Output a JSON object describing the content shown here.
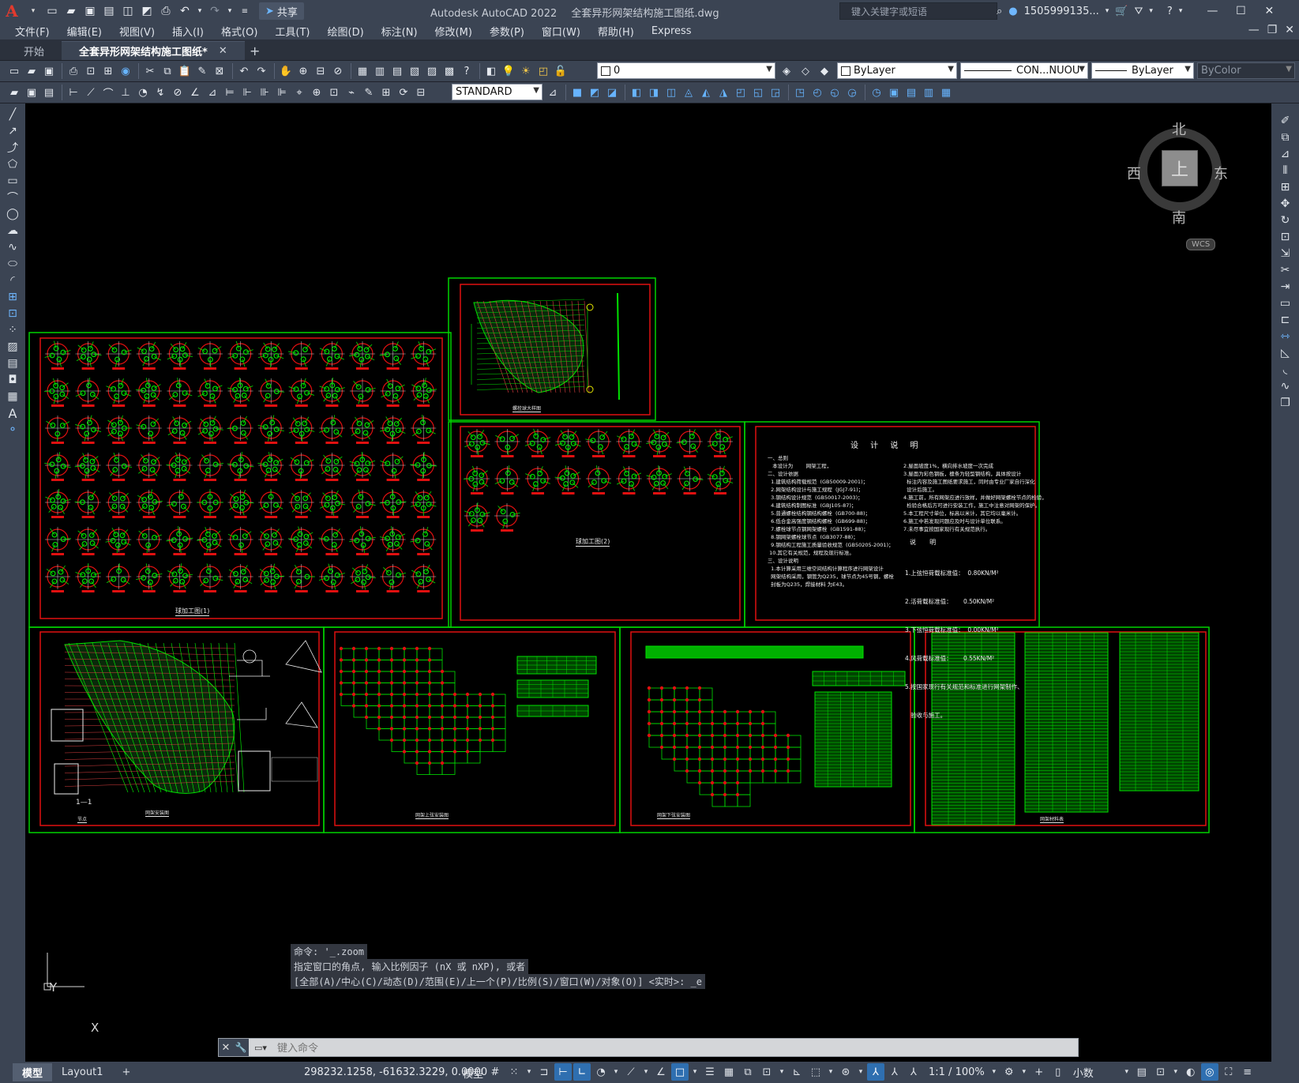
{
  "app": {
    "name": "Autodesk AutoCAD 2022",
    "file": "全套异形网架结构施工图纸.dwg",
    "logo": "A",
    "search_placeholder": "键入关键字或短语",
    "user": "1505999135...",
    "share_label": "共享"
  },
  "menu": [
    "文件(F)",
    "编辑(E)",
    "视图(V)",
    "插入(I)",
    "格式(O)",
    "工具(T)",
    "绘图(D)",
    "标注(N)",
    "修改(M)",
    "参数(P)",
    "窗口(W)",
    "帮助(H)",
    "Express"
  ],
  "tabs": [
    {
      "label": "开始",
      "active": false
    },
    {
      "label": "全套异形网架结构施工图纸*",
      "active": true
    }
  ],
  "toolbar": {
    "layer_value": "0",
    "color_value": "ByLayer",
    "linetype_value": "CON...NUOU",
    "lineweight_value": "ByLayer",
    "plotstyle_value": "ByColor",
    "textstyle_value": "STANDARD"
  },
  "viewcube": {
    "north": "北",
    "south": "南",
    "east": "东",
    "west": "西",
    "face": "上",
    "wcs": "WCS"
  },
  "drawing": {
    "notes_title": "设 计 说 明",
    "notes_left": "一、总则\n   本设计为        网架工程，\n二、设计依据\n  1.建筑结构荷载规范  (GB50009-2001)；\n  2.网架结构设计与施工规程  (JGJ7-91)；\n  3.钢结构设计规范  (GB50017-2003)；\n  4.建筑结构制图标准  (GBJ105-87)；\n  5.普通螺栓结构钢结构螺栓  (GB700-88)；\n  6.低合金高强度钢结构螺栓  (GB699-88)；\n  7.螺栓球节点钢网架螺栓  (GB1591-88)；\n  8.钢网架螺栓球节点  (GB3077-88)；\n  9.钢结构工程施工质量验收规范  (GB50205-2001)；\n 10.其它有关规范，规程及现行标准。\n三、设计说明\n  1.本计算采用三维空间结构计算程序进行网架设计\n  网架结构采用，钢管为Q235，球节点为45号钢，螺栓\n  封板为Q235，焊接材料 为E43。",
    "notes_right": "2.屋面坡度1%，横向排水坡度一次完成\n3.屋面为彩色钢板，檩条为轻型钢结构，具体按设计\n  标注内容及施工图纸要求施工，同时由专业厂家自行深化\n  设计后施工。\n4.施工前，所有网架应进行放样，并做好网架螺栓节点的检验，\n  检验合格后方可进行安装工作，施工中注意对网架的保护。\n5.本工程尺寸单位，标高以米计，其它均以毫米计。\n6.施工中若发现问题应及时与设计单位联系。\n7.未尽事宜按国家现行有关规范执行。",
    "loads_title": "说  明",
    "loads": [
      "1.上弦恒荷载标准值：  0.80KN/M²",
      "2.活荷载标准值：      0.50KN/M²",
      "3.下弦恒荷载标准值：  0.00KN/M²",
      "4.风荷载标准值：      0.55KN/M²",
      "5.按国家现行有关规范和标准进行网架制作、",
      "   验收与施工。"
    ],
    "sheet_titles": [
      "螺栓球大样图",
      "球加工图(1)",
      "球加工图(2)",
      "网架安装图",
      "网架上弦安装图",
      "网架下弦安装图",
      "网架材料表"
    ],
    "section_label": "1—1",
    "section_label2": "节点"
  },
  "command": {
    "history": [
      "命令: '_.zoom",
      "指定窗口的角点, 输入比例因子 (nX 或 nXP), 或者",
      "[全部(A)/中心(C)/动态(D)/范围(E)/上一个(P)/比例(S)/窗口(W)/对象(O)] <实时>: _e"
    ],
    "placeholder": "键入命令"
  },
  "ucs": {
    "x": "X",
    "y": "Y"
  },
  "status": {
    "tabs": [
      "模型",
      "Layout1"
    ],
    "coords": "298232.1258, -61632.3229, 0.0000",
    "model": "模型",
    "scale": "1:1 / 100%",
    "units": "小数"
  }
}
